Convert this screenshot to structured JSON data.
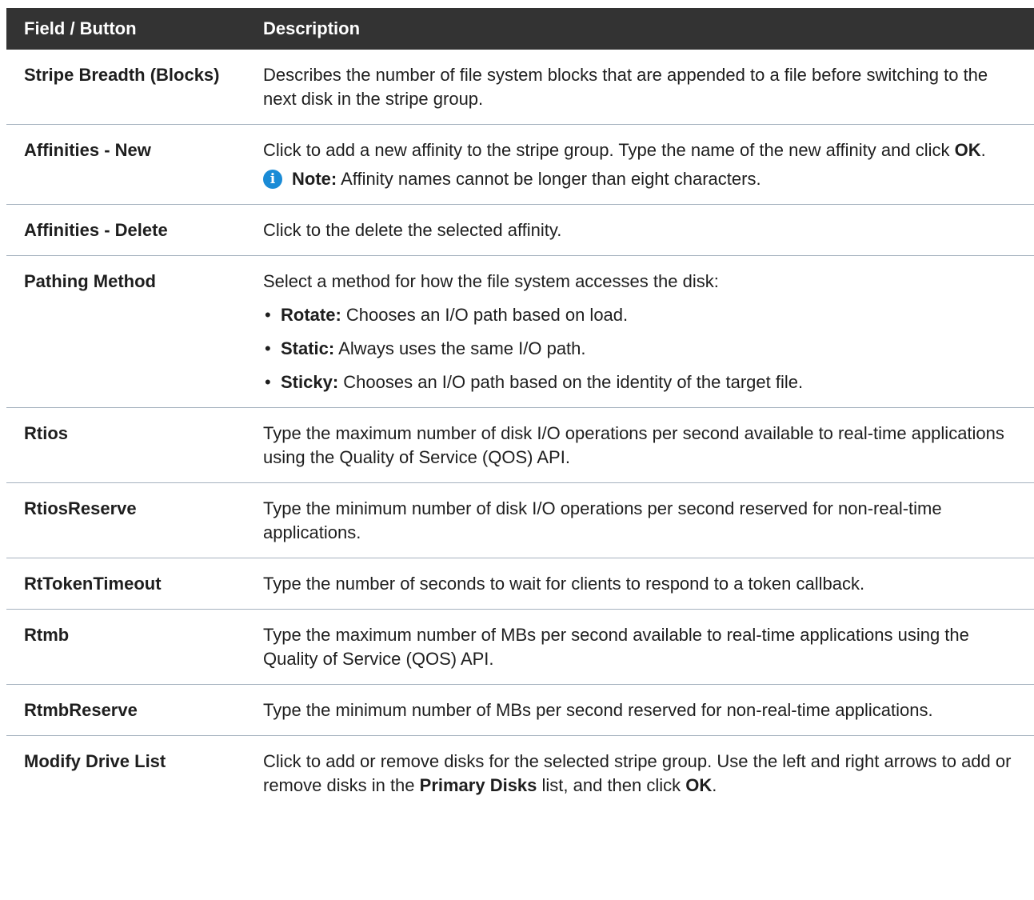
{
  "table": {
    "header": {
      "field": "Field / Button",
      "description": "Description"
    },
    "rows": {
      "stripe_breadth": {
        "field": "Stripe Breadth (Blocks)",
        "desc": "Describes the number of file system blocks that are appended to a file before switching to the next disk in the stripe group."
      },
      "affinities_new": {
        "field": "Affinities - New",
        "desc_pre": "Click to add a new affinity to the stripe group. Type the name of the new affinity and click ",
        "desc_bold": "OK",
        "desc_post": ".",
        "note_label": "Note:",
        "note_text": " Affinity names cannot be longer than eight characters.",
        "note_icon": "info-icon"
      },
      "affinities_delete": {
        "field": "Affinities - Delete",
        "desc": "Click to the delete the selected affinity."
      },
      "pathing_method": {
        "field": "Pathing Method",
        "desc": "Select a method for how the file system accesses the disk:",
        "options": [
          {
            "label": "Rotate:",
            "text": " Chooses an I/O path based on load."
          },
          {
            "label": "Static:",
            "text": " Always uses the same I/O path."
          },
          {
            "label": "Sticky:",
            "text": " Chooses an I/O path based on the identity of the target file."
          }
        ]
      },
      "rtios": {
        "field": "Rtios",
        "desc": "Type the maximum number of disk I/O operations per second available to real-time applications using the Quality of Service (QOS) API."
      },
      "rtios_reserve": {
        "field": "RtiosReserve",
        "desc": "Type the minimum number of disk I/O operations per second reserved for non-real-time applications."
      },
      "rt_token_timeout": {
        "field": "RtTokenTimeout",
        "desc": "Type the number of seconds to wait for clients to respond to a token callback."
      },
      "rtmb": {
        "field": "Rtmb",
        "desc": "Type the maximum number of MBs per second available to real-time applications using the Quality of Service (QOS) API."
      },
      "rtmb_reserve": {
        "field": "RtmbReserve",
        "desc": "Type the minimum number of MBs per second reserved for non-real-time applications."
      },
      "modify_drive_list": {
        "field": "Modify Drive List",
        "desc_pre": "Click to add or remove disks for the selected stripe group. Use the left and right arrows to add or remove disks in the ",
        "desc_bold1": "Primary Disks",
        "desc_mid": " list, and then click ",
        "desc_bold2": "OK",
        "desc_post": "."
      }
    }
  },
  "colors": {
    "header_bg": "#333333",
    "header_text": "#ffffff",
    "row_divider": "#a6b2bf",
    "info_icon": "#1a8bd6"
  }
}
